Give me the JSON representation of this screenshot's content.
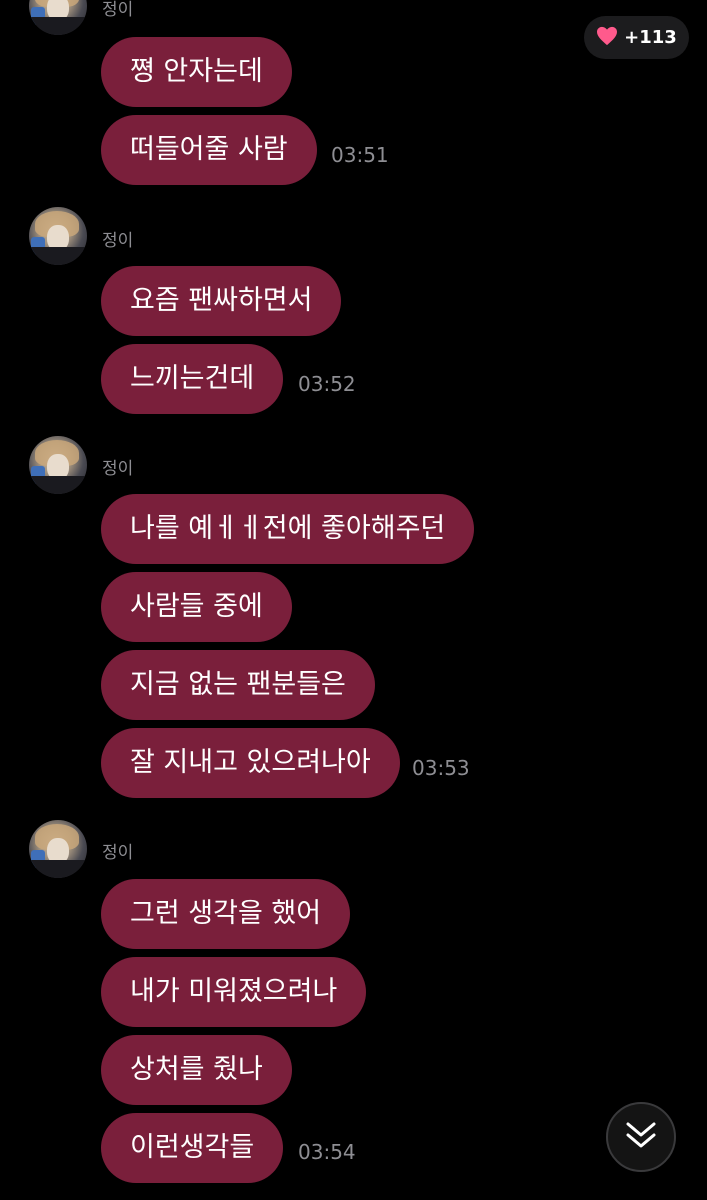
{
  "like": {
    "count": "+113",
    "icon": "heart-icon",
    "color": "#ff5a8c"
  },
  "colors": {
    "background": "#000000",
    "bubble": "#7a1f3b",
    "muted_text": "#8e8e93"
  },
  "groups": [
    {
      "sender": "정이",
      "messages": [
        "쪙 안자는데",
        "떠들어줄 사람"
      ],
      "time": "03:51"
    },
    {
      "sender": "정이",
      "messages": [
        "요즘 팬싸하면서",
        "느끼는건데"
      ],
      "time": "03:52"
    },
    {
      "sender": "정이",
      "messages": [
        "나를 예ㅔㅔ전에 좋아해주던",
        "사람들 중에",
        "지금 없는 팬분들은",
        "잘 지내고 있으려나아"
      ],
      "time": "03:53"
    },
    {
      "sender": "정이",
      "messages": [
        "그런 생각을 했어",
        "내가 미워졌으려나",
        "상처를 줬나",
        "이런생각들"
      ],
      "time": "03:54"
    }
  ],
  "scroll_button": {
    "icon": "double-chevron-down-icon"
  }
}
